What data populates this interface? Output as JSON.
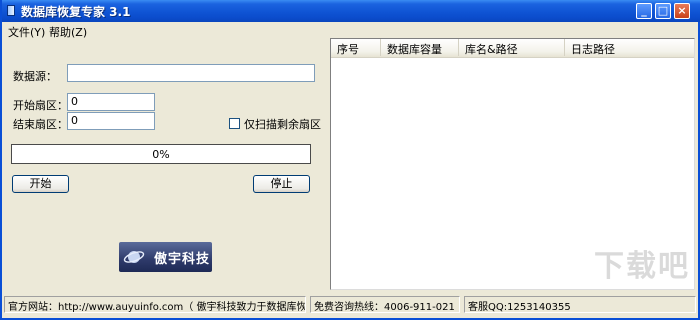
{
  "window": {
    "title": "数据库恢复专家 3.1",
    "minimize": "_",
    "maximize": "□",
    "close": "×"
  },
  "menu": {
    "items": [
      "文件(Y)",
      "帮助(Z)"
    ]
  },
  "form": {
    "data_source_label": "数据源：",
    "data_source_value": "",
    "start_sector_label": "开始扇区：",
    "start_sector_value": "0",
    "end_sector_label": "结束扇区：",
    "end_sector_value": "0",
    "scan_remaining_label": "仅扫描剩余扇区",
    "scan_remaining_checked": false,
    "progress_text": "0%",
    "progress_fraction": 0,
    "start_button": "开始",
    "stop_button": "停止"
  },
  "logo": {
    "text": "傲宇科技"
  },
  "list": {
    "columns": [
      "序号",
      "数据库容量",
      "库名&路径",
      "日志路径"
    ]
  },
  "status": {
    "website": "官方网站：http://www.auyuinfo.com（ 傲宇科技致力于数据库恢复）",
    "hotline": "免费咨询热线：4006-911-021",
    "qq": "客服QQ:1253140355"
  },
  "watermark": {
    "text": "下载吧"
  },
  "colors": {
    "titlebar": "#0b4ccc",
    "window_bg": "#ece9d8",
    "progress_fill": "#2a6fd8"
  }
}
